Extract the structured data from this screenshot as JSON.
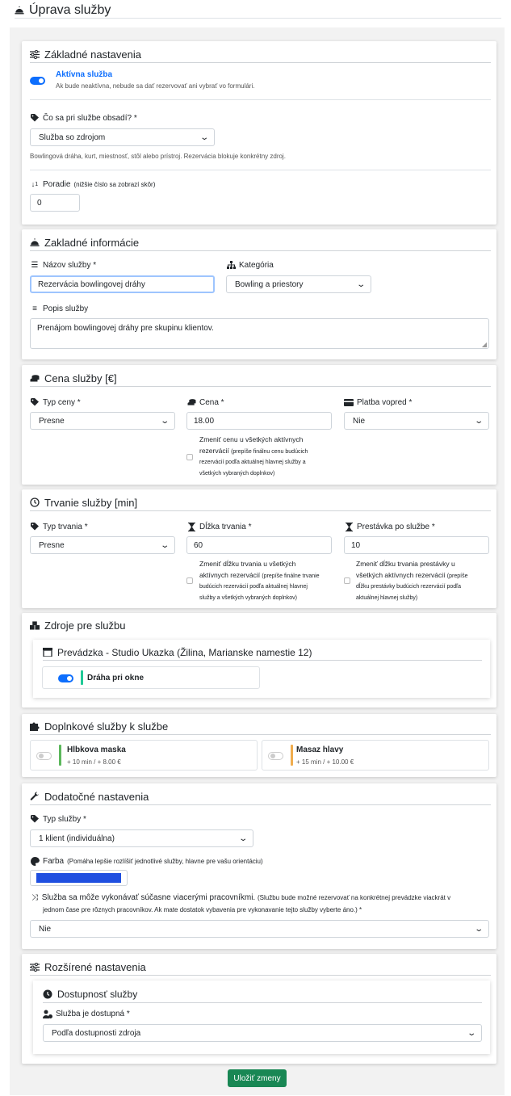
{
  "page": {
    "title": "Úprava služby"
  },
  "basic_settings": {
    "title": "Základné nastavenia",
    "active_label": "Aktívna služba",
    "active_help": "Ak bude neaktívna, nebude sa dať rezervovať ani vybrať vo formulári.",
    "assign_label": "Čo sa pri službe obsadí? *",
    "assign_value": "Služba so zdrojom",
    "assign_help": "Bowlingová dráha, kurt, miestnosť, stôl alebo prístroj. Rezervácia blokuje konkrétny zdroj.",
    "order_label": "Poradie",
    "order_hint": "(nižšie číslo sa zobrazí skôr)",
    "order_value": "0"
  },
  "basic_info": {
    "title": "Zakladné informácie",
    "name_label": "Názov služby *",
    "name_value": "Rezervácia bowlingovej dráhy",
    "category_label": "Kategória",
    "category_value": "Bowling a priestory",
    "description_label": "Popis služby",
    "description_value": "Prenájom bowlingovej dráhy pre skupinu klientov."
  },
  "price": {
    "title": "Cena služby [€]",
    "type_label": "Typ ceny *",
    "type_value": "Presne",
    "price_label": "Cena *",
    "price_value": "18.00",
    "prepay_label": "Platba vopred *",
    "prepay_value": "Nie",
    "note_line1": "Zmeniť cenu u všetkých aktívnych",
    "note_line2": "rezervácií",
    "note_line2_small": "(prepíše finálnu cenu budúcich",
    "note_line3": "rezervácií podľa aktuálnej hlavnej služby a",
    "note_line4": "všetkých vybraných doplnkov)"
  },
  "duration": {
    "title": "Trvanie služby [min]",
    "type_label": "Typ trvania *",
    "type_value": "Presne",
    "length_label": "Dĺžka trvania *",
    "length_value": "60",
    "break_label": "Prestávka po službe *",
    "break_value": "10",
    "length_note1": "Zmeniť dĺžku trvania u všetkých",
    "length_note2": "aktívnych rezervácií",
    "length_note2_small": "(prepíše finálne trvanie",
    "length_note3": "budúcich rezervácií podľa aktuálnej hlavnej",
    "length_note4": "služby a všetkých vybraných doplnkov)",
    "break_note1": "Zmeniť dĺžku trvania prestávky u",
    "break_note2": "všetkých aktívnych rezervácií",
    "break_note2_small": "(prepíše",
    "break_note3": "dĺžku prestávky budúcich rezervácií podľa",
    "break_note4": "aktuálnej hlavnej služby)"
  },
  "resources": {
    "title": "Zdroje pre službu",
    "location_title": "Prevádzka - Studio Ukazka (Žilina, Marianske namestie 12)",
    "resource_name": "Dráha pri okne",
    "resource_color": "#20c997"
  },
  "addons": {
    "title": "Doplnkové služby k službe",
    "items": [
      {
        "name": "Hlbkova maska",
        "detail": "+ 10 min / + 8.00 €",
        "color": "#5cb85c"
      },
      {
        "name": "Masaz hlavy",
        "detail": "+ 15 min / + 10.00 €",
        "color": "#f0ad4e"
      }
    ]
  },
  "additional": {
    "title": "Dodatočné nastavenia",
    "service_type_label": "Typ služby *",
    "service_type_value": "1 klient (individuálna)",
    "color_label": "Farba",
    "color_hint": "(Pomáha lepšie rozlíšiť jednotlivé služby, hlavne pre vašu orientáciu)",
    "color_value": "#1f4fe0",
    "multi_label": "Služba sa môže vykonávať súčasne viacerými pracovníkmi.",
    "multi_hint1": "(Službu bude možné rezervovať na konkrétnej prevádzke viackrát v",
    "multi_hint2": "jednom čase pre rôznych pracovníkov. Ak mate dostatok vybavenia pre vykonavanie tejto služby vyberte áno.) *",
    "multi_value": "Nie"
  },
  "extended": {
    "title": "Rozšírené nastavenia",
    "availability_title": "Dostupnosť služby",
    "available_label": "Služba je dostupná *",
    "available_value": "Podľa dostupnosti zdroja"
  },
  "actions": {
    "save_label": "Uložiť zmeny"
  }
}
